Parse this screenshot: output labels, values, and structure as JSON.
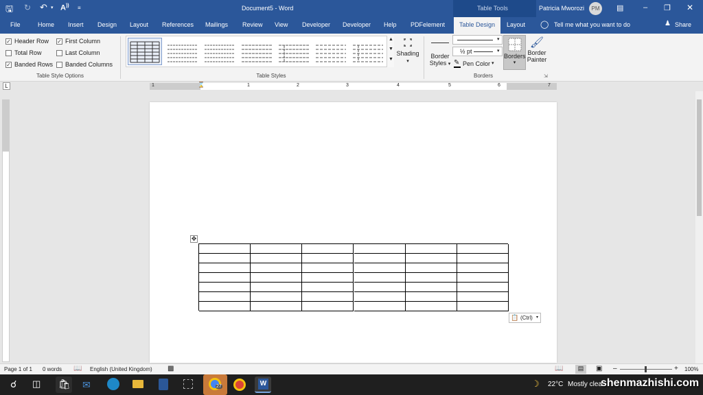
{
  "titlebar": {
    "doc_title": "Document5  -  Word",
    "context": "Table Tools",
    "user": "Patricia Mworozi",
    "initials": "PM"
  },
  "tabs": [
    "File",
    "Home",
    "Insert",
    "Design",
    "Layout",
    "References",
    "Mailings",
    "Review",
    "View",
    "Developer",
    "Developer",
    "Help",
    "PDFelement",
    "Table Design",
    "Layout"
  ],
  "tell_me": "Tell me what you want to do",
  "share": "Share",
  "style_options": {
    "items": [
      {
        "label": "Header Row",
        "checked": true
      },
      {
        "label": "First Column",
        "checked": true
      },
      {
        "label": "Total Row",
        "checked": false
      },
      {
        "label": "Last Column",
        "checked": false
      },
      {
        "label": "Banded Rows",
        "checked": true
      },
      {
        "label": "Banded Columns",
        "checked": false
      }
    ],
    "group_label": "Table Style Options"
  },
  "table_styles": {
    "group_label": "Table Styles",
    "shading": "Shading"
  },
  "borders": {
    "border_styles": "Border",
    "border_styles2": "Styles",
    "pen_weight": "½ pt",
    "pen_color": "Pen Color",
    "borders_btn": "Borders",
    "painter": "Border",
    "painter2": "Painter",
    "group_label": "Borders"
  },
  "ruler": {
    "numbers": [
      "1",
      "1",
      "2",
      "3",
      "4",
      "5",
      "6",
      "7"
    ]
  },
  "paste_options": "(Ctrl)",
  "status": {
    "page": "Page 1 of 1",
    "words": "0 words",
    "language": "English (United Kingdom)",
    "zoom": "100%"
  },
  "taskbar": {
    "weather": "22°C",
    "weather_text": "Mostly clea",
    "watermark": "shenmazhishi.com",
    "chrome_badge": "27"
  },
  "colors": {
    "accent": "#2b579a",
    "taskbar": "#1f1f1f"
  }
}
